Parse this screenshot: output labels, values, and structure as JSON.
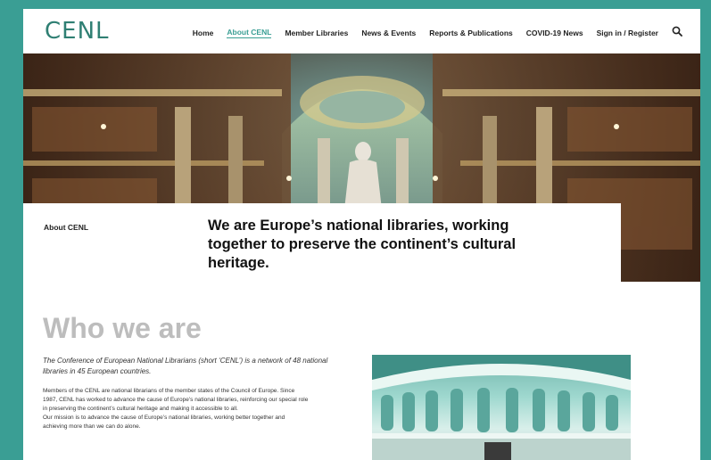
{
  "header": {
    "logo": "CENL",
    "nav": [
      {
        "label": "Home"
      },
      {
        "label": "About CENL",
        "active": true
      },
      {
        "label": "Member Libraries"
      },
      {
        "label": "News & Events"
      },
      {
        "label": "Reports & Publications"
      },
      {
        "label": "COVID-19 News"
      },
      {
        "label": "Sign in / Register"
      }
    ],
    "search_icon": "search-icon"
  },
  "intro": {
    "label": "About CENL",
    "heading": "We are Europe’s national libraries, working together to preserve the continent’s cultural heritage."
  },
  "who": {
    "title": "Who we are",
    "lead": "The Conference of European National Librarians (short ‘CENL’) is a network of 48 national libraries in 45 European countries.",
    "body_1": "Members of the CENL are national librarians of the member states of the Council of Europe. Since 1987, CENL has worked to advance the cause of Europe’s national libraries, reinforcing our special role in preserving the continent’s cultural heritage and making it accessible to all.",
    "body_2": "Our mission is to advance the cause of Europe’s national libraries, working better together and achieving more than we can do alone."
  },
  "colors": {
    "frame": "#3a9e94",
    "accent": "#3a9e94",
    "logo": "#2f7f73",
    "title_gray": "#bdbdbd"
  }
}
